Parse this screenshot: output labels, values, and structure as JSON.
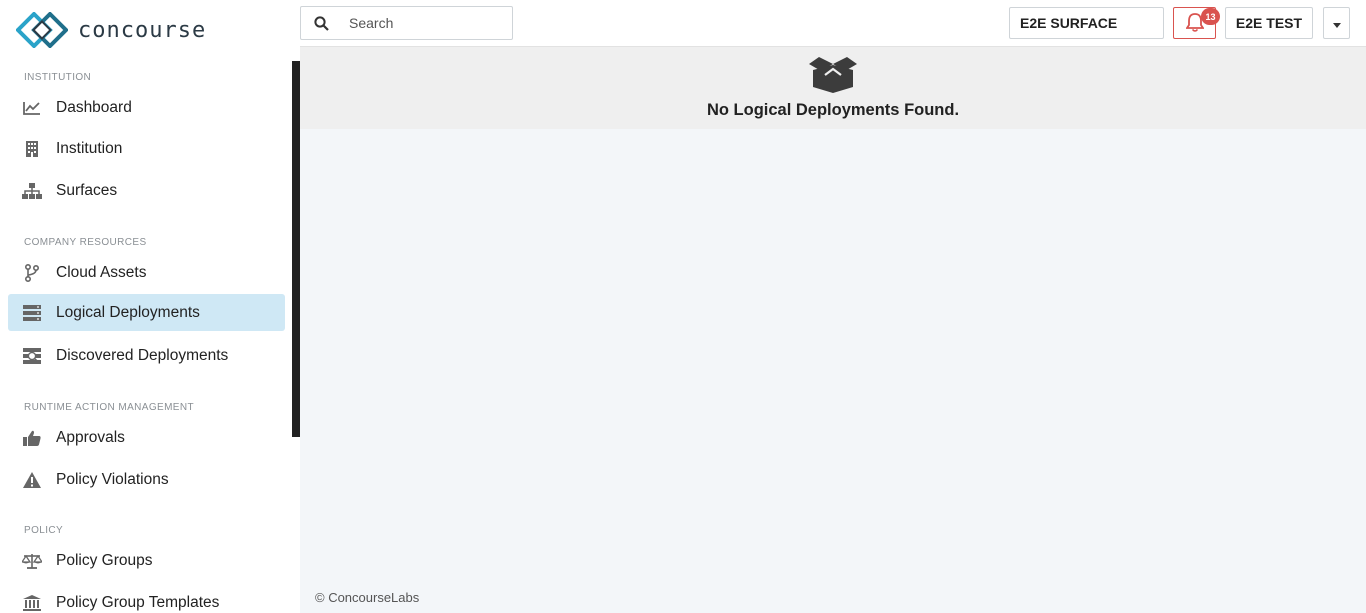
{
  "app": {
    "logo_text": "concourse"
  },
  "sidebar": {
    "sections": [
      {
        "label": "INSTITUTION"
      },
      {
        "label": "COMPANY RESOURCES"
      },
      {
        "label": "RUNTIME ACTION MANAGEMENT"
      },
      {
        "label": "POLICY"
      }
    ],
    "items": [
      {
        "label": "Dashboard",
        "icon": "chart-line-icon"
      },
      {
        "label": "Institution",
        "icon": "building-icon"
      },
      {
        "label": "Surfaces",
        "icon": "sitemap-icon"
      },
      {
        "label": "Cloud Assets",
        "icon": "code-branch-icon"
      },
      {
        "label": "Logical Deployments",
        "icon": "server-icon",
        "active": true
      },
      {
        "label": "Discovered Deployments",
        "icon": "discovered-icon"
      },
      {
        "label": "Approvals",
        "icon": "thumbs-up-icon"
      },
      {
        "label": "Policy Violations",
        "icon": "warning-icon"
      },
      {
        "label": "Policy Groups",
        "icon": "balance-scale-icon"
      },
      {
        "label": "Policy Group Templates",
        "icon": "university-icon"
      }
    ]
  },
  "topbar": {
    "search_placeholder": "Search",
    "surface_label": "E2E SURFACE",
    "notification_count": "13",
    "user_label": "E2E TEST"
  },
  "main": {
    "empty_message": "No Logical Deployments Found.",
    "footer": "© ConcourseLabs"
  },
  "colors": {
    "accent": "#2aa3c9",
    "active_bg": "#cfe8f5",
    "alert": "#d9534f"
  }
}
